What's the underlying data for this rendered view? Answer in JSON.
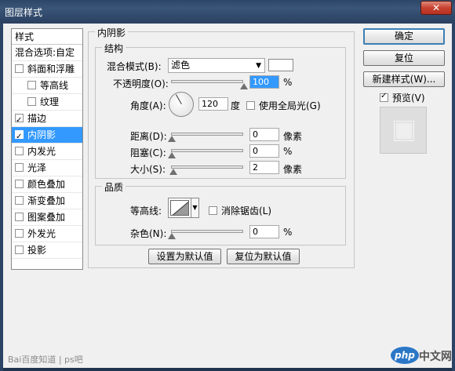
{
  "window": {
    "title": "图层样式",
    "close_glyph": "✕"
  },
  "style_list": {
    "header": "样式",
    "blend_options": "混合选项:自定",
    "items": [
      {
        "label": "斜面和浮雕",
        "checked": false,
        "indent": false
      },
      {
        "label": "等高线",
        "checked": false,
        "indent": true
      },
      {
        "label": "纹理",
        "checked": false,
        "indent": true
      },
      {
        "label": "描边",
        "checked": true,
        "indent": false
      },
      {
        "label": "内阴影",
        "checked": true,
        "indent": false,
        "selected": true
      },
      {
        "label": "内发光",
        "checked": false,
        "indent": false
      },
      {
        "label": "光泽",
        "checked": false,
        "indent": false
      },
      {
        "label": "颜色叠加",
        "checked": false,
        "indent": false
      },
      {
        "label": "渐变叠加",
        "checked": false,
        "indent": false
      },
      {
        "label": "图案叠加",
        "checked": false,
        "indent": false
      },
      {
        "label": "外发光",
        "checked": false,
        "indent": false
      },
      {
        "label": "投影",
        "checked": false,
        "indent": false
      }
    ]
  },
  "inner_shadow": {
    "title": "内阴影",
    "structure": {
      "title": "结构",
      "blend_mode_label": "混合模式(B):",
      "blend_mode_value": "滤色",
      "blend_color": "#ffffff",
      "opacity_label": "不透明度(O):",
      "opacity_value": "100",
      "opacity_unit": "%",
      "angle_label": "角度(A):",
      "angle_value": "120",
      "angle_unit": "度",
      "global_light_label": "使用全局光(G)",
      "global_light_checked": false,
      "distance_label": "距离(D):",
      "distance_value": "0",
      "distance_unit": "像素",
      "choke_label": "阻塞(C):",
      "choke_value": "0",
      "choke_unit": "%",
      "size_label": "大小(S):",
      "size_value": "2",
      "size_unit": "像素"
    },
    "quality": {
      "title": "品质",
      "contour_label": "等高线:",
      "antialias_label": "消除锯齿(L)",
      "antialias_checked": false,
      "noise_label": "杂色(N):",
      "noise_value": "0",
      "noise_unit": "%"
    },
    "make_default_label": "设置为默认值",
    "reset_default_label": "复位为默认值"
  },
  "buttons": {
    "ok": "确定",
    "reset": "复位",
    "new_style": "新建样式(W)...",
    "preview_label": "预览(V)",
    "preview_checked": true
  },
  "watermark": {
    "baidu": "Bai百度知道 | ps吧",
    "php": "php",
    "cn": "中文网"
  }
}
